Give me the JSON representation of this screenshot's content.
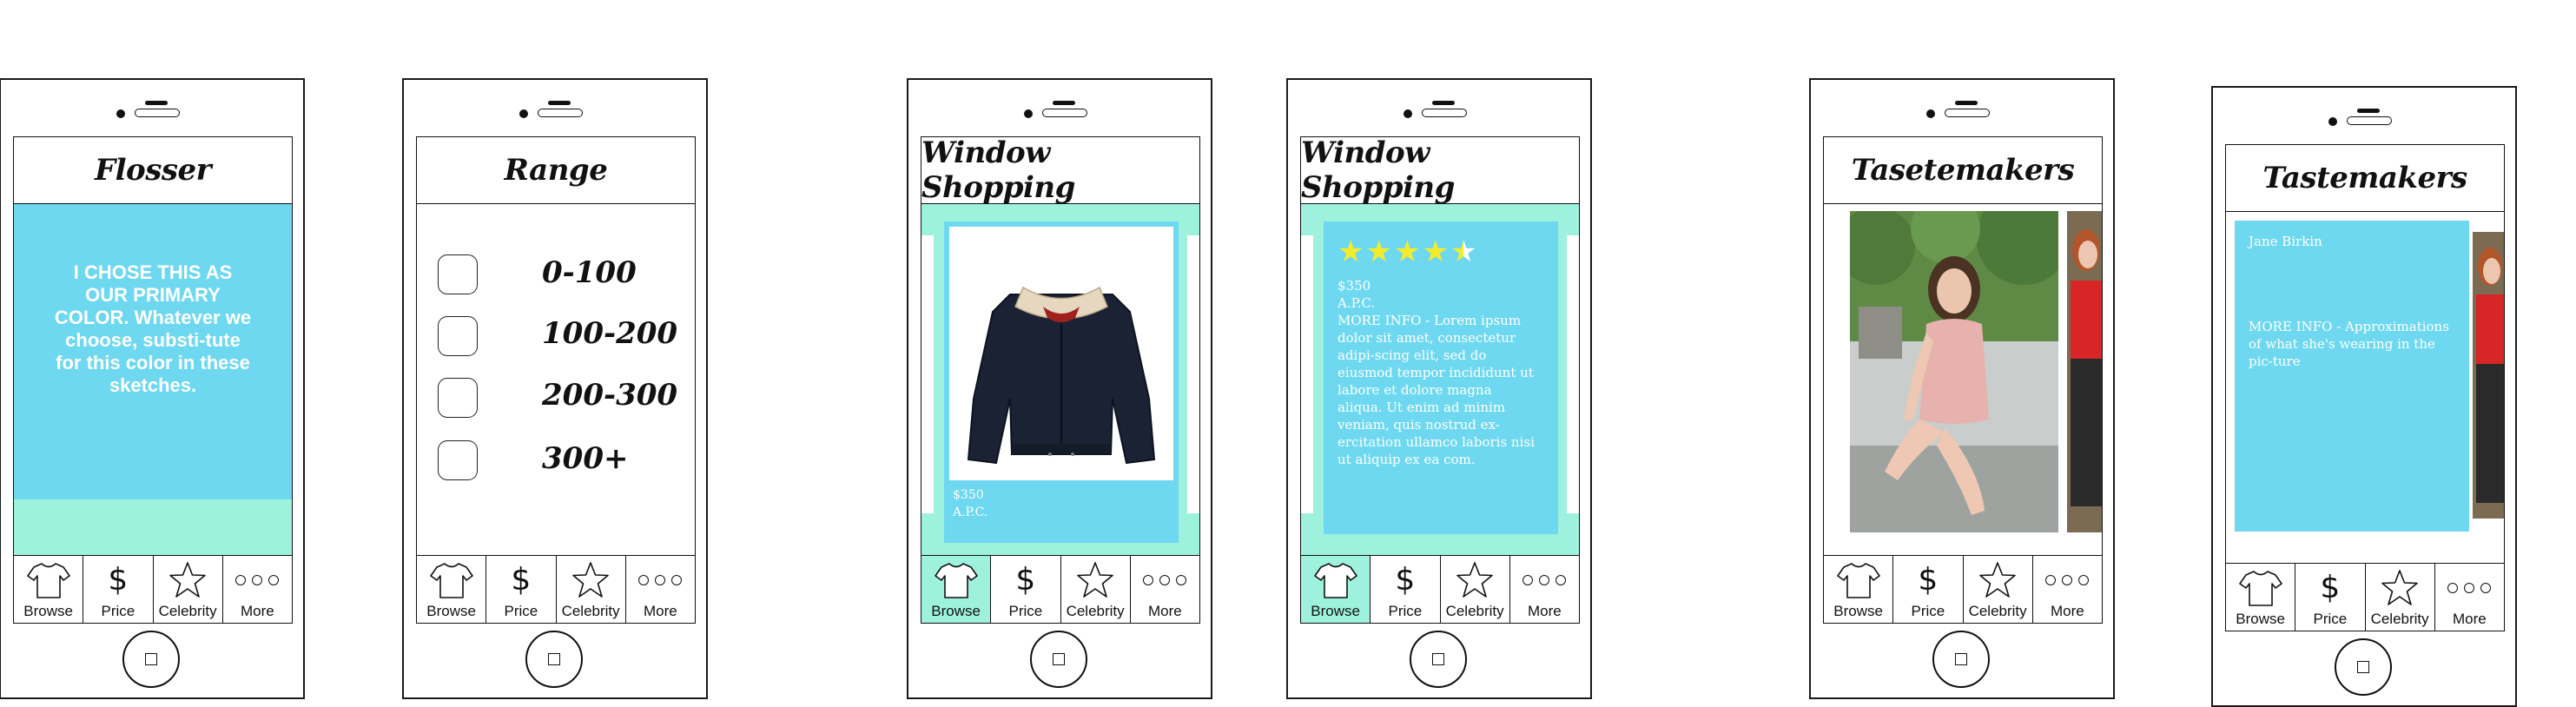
{
  "tabs": [
    {
      "label": "Browse",
      "icon": "shirt-icon"
    },
    {
      "label": "Price",
      "icon": "dollar-icon"
    },
    {
      "label": "Celebrity",
      "icon": "star-icon"
    },
    {
      "label": "More",
      "icon": "more-dots-icon"
    }
  ],
  "colors": {
    "primary": "#6ed8f0",
    "secondary": "#9ef2dd",
    "star": "#f3ec2e"
  },
  "phones": [
    {
      "title": "Flosser",
      "body": "I CHOSE THIS AS OUR PRIMARY COLOR. Whatever we choose, substi-tute for this color in these sketches."
    },
    {
      "title": "Range",
      "ranges": [
        "0-100",
        "100-200",
        "200-300",
        "300+"
      ]
    },
    {
      "title": "Window Shopping",
      "price": "$350",
      "brand": "A.P.C."
    },
    {
      "title": "Window Shopping",
      "rating": 4.5,
      "price": "$350",
      "brand": "A.P.C.",
      "info": "MORE INFO - Lorem ipsum dolor sit amet, consectetur adipi-scing elit, sed do eiusmod tempor incididunt ut labore et dolore magna aliqua. Ut enim ad minim veniam, quis nostrud ex-ercitation ullamco laboris nisi ut aliquip ex ea com."
    },
    {
      "title": "Tasetemakers"
    },
    {
      "title": "Tastemakers",
      "name": "Jane Birkin",
      "info": "MORE INFO - Approximations of what she's wearing in the pic-ture"
    }
  ]
}
